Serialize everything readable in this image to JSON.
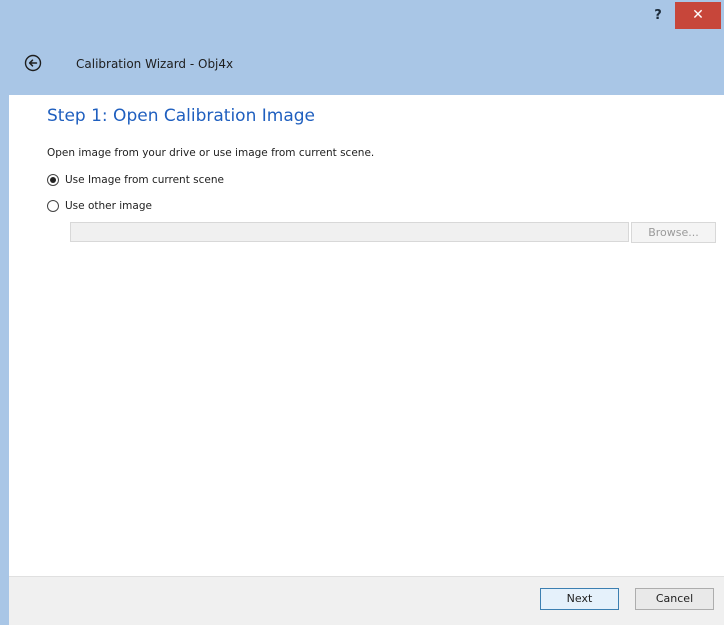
{
  "window": {
    "title": "Calibration Wizard - Obj4x",
    "help_label": "?",
    "close_label": "✕"
  },
  "step": {
    "title": "Step 1: Open Calibration Image",
    "instructions": "Open image from your drive or use image from current scene."
  },
  "options": {
    "use_current_scene_label": "Use Image from current scene",
    "use_other_image_label": "Use other image",
    "selected": "use_current_scene"
  },
  "file_input": {
    "value": "",
    "placeholder": ""
  },
  "buttons": {
    "browse_label": "Browse...",
    "next_label": "Next",
    "cancel_label": "Cancel"
  },
  "colors": {
    "titlebar": "#a9c6e6",
    "close_button": "#c7463a",
    "step_title": "#1f5fbf"
  }
}
